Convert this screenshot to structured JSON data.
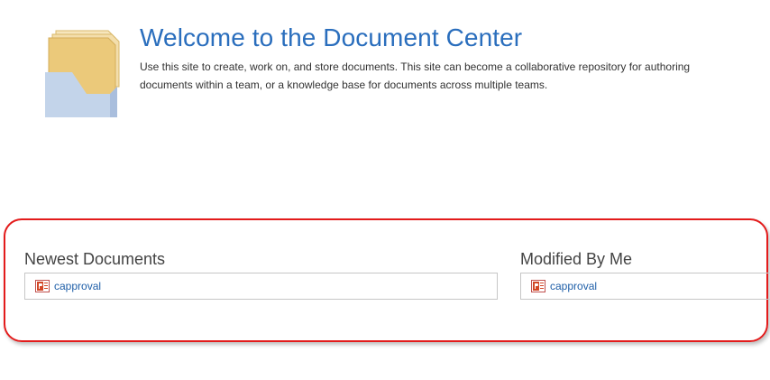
{
  "header": {
    "title": "Welcome to the Document Center",
    "description": "Use this site to create, work on, and store documents. This site can become a collaborative repository for authoring documents within a team, or a knowledge base for documents across multiple teams."
  },
  "web_parts": {
    "newest": {
      "title": "Newest Documents",
      "items": [
        {
          "label": "capproval",
          "icon": "powerpoint-file-icon"
        }
      ]
    },
    "modified": {
      "title": "Modified By Me",
      "items": [
        {
          "label": "capproval",
          "icon": "powerpoint-file-icon"
        }
      ]
    }
  },
  "colors": {
    "title": "#2a6ebd",
    "link": "#1f5fa8",
    "highlight_border": "#e31b1b",
    "folder": "#ebc97a",
    "tray": "#c3d4ea"
  }
}
